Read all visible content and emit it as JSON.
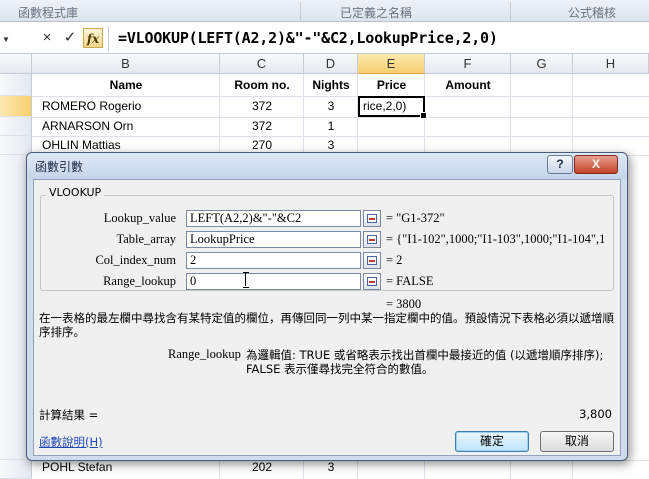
{
  "ribbon_groups": [
    "函數程式庫",
    "已定義之名稱",
    "公式稽核"
  ],
  "formula_bar": {
    "cancel_icon": "×",
    "enter_icon": "✓",
    "fx_label": "fx",
    "formula": "=VLOOKUP(LEFT(A2,2)&\"-\"&C2,LookupPrice,2,0)"
  },
  "columns": [
    "B",
    "C",
    "D",
    "E",
    "F",
    "G",
    "H"
  ],
  "table": {
    "headers": {
      "name": "Name",
      "room": "Room no.",
      "nights": "Nights",
      "price": "Price",
      "amount": "Amount"
    },
    "rows": [
      {
        "name": "ROMERO Rogerio",
        "room": "372",
        "nights": "3"
      },
      {
        "name": "ARNARSON Orn",
        "room": "372",
        "nights": "1"
      },
      {
        "name": "OHLIN Mattias",
        "room": "270",
        "nights": "3"
      }
    ],
    "active_cell_text": "rice,2,0)",
    "partial_rows": [
      {
        "name": "POHL Stefan",
        "room": "202",
        "nights": "3"
      }
    ]
  },
  "dialog": {
    "title": "函數引數",
    "help_symbol": "?",
    "close_symbol": "X",
    "function_name": "VLOOKUP",
    "args": [
      {
        "label": "Lookup_value",
        "value": "LEFT(A2,2)&\"-\"&C2",
        "result": "=  \"G1-372\""
      },
      {
        "label": "Table_array",
        "value": "LookupPrice",
        "result": "=  {\"I1-102\",1000;\"I1-103\",1000;\"I1-104\",1"
      },
      {
        "label": "Col_index_num",
        "value": "2",
        "result": "=  2"
      },
      {
        "label": "Range_lookup",
        "value": "0",
        "result": "=  FALSE"
      }
    ],
    "overall_result": "=  3800",
    "description": "在一表格的最左欄中尋找含有某特定值的欄位，再傳回同一列中某一指定欄中的值。預設情況下表格必須以遞增順序排序。",
    "arg_help_name": "Range_lookup",
    "arg_help_line1": "為邏輯值: TRUE 或省略表示找出首欄中最接近的值 (以遞增順序排序);",
    "arg_help_line2": "FALSE 表示僅尋找完全符合的數值。",
    "calc_label": "計算結果 =",
    "calc_value": "3,800",
    "help_link": "函數說明(H)",
    "ok_label": "確定",
    "cancel_label": "取消"
  }
}
